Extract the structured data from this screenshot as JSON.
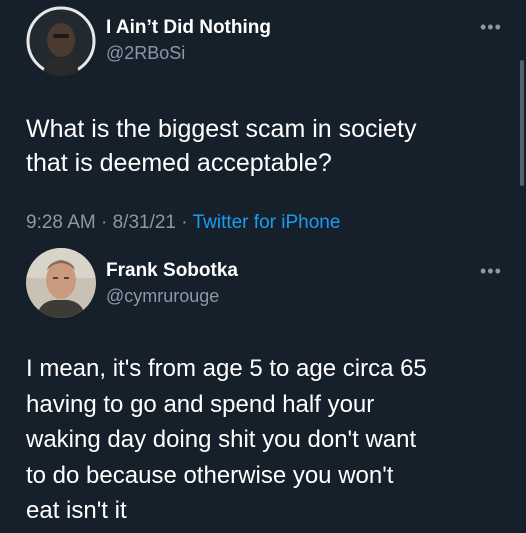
{
  "tweet": {
    "author_name": "I Ain’t Did Nothing",
    "author_handle": "@2RBoSi",
    "text": "What is the biggest scam in society\nthat is deemed acceptable?",
    "time": "9:28 AM",
    "date": "8/31/21",
    "separator": "·",
    "source": "Twitter for iPhone",
    "more_icon": "more-horizontal-icon"
  },
  "reply": {
    "author_name": "Frank Sobotka",
    "author_handle": "@cymrurouge",
    "text": "I mean, it's from age 5 to age circa 65\nhaving to go and spend half your\nwaking day doing shit you don't want\nto do because otherwise you won't\neat isn't it",
    "more_icon": "more-horizontal-icon"
  },
  "colors": {
    "background": "#15202b",
    "text": "#ffffff",
    "secondary": "#8b98a5",
    "link": "#1d9bf0"
  }
}
